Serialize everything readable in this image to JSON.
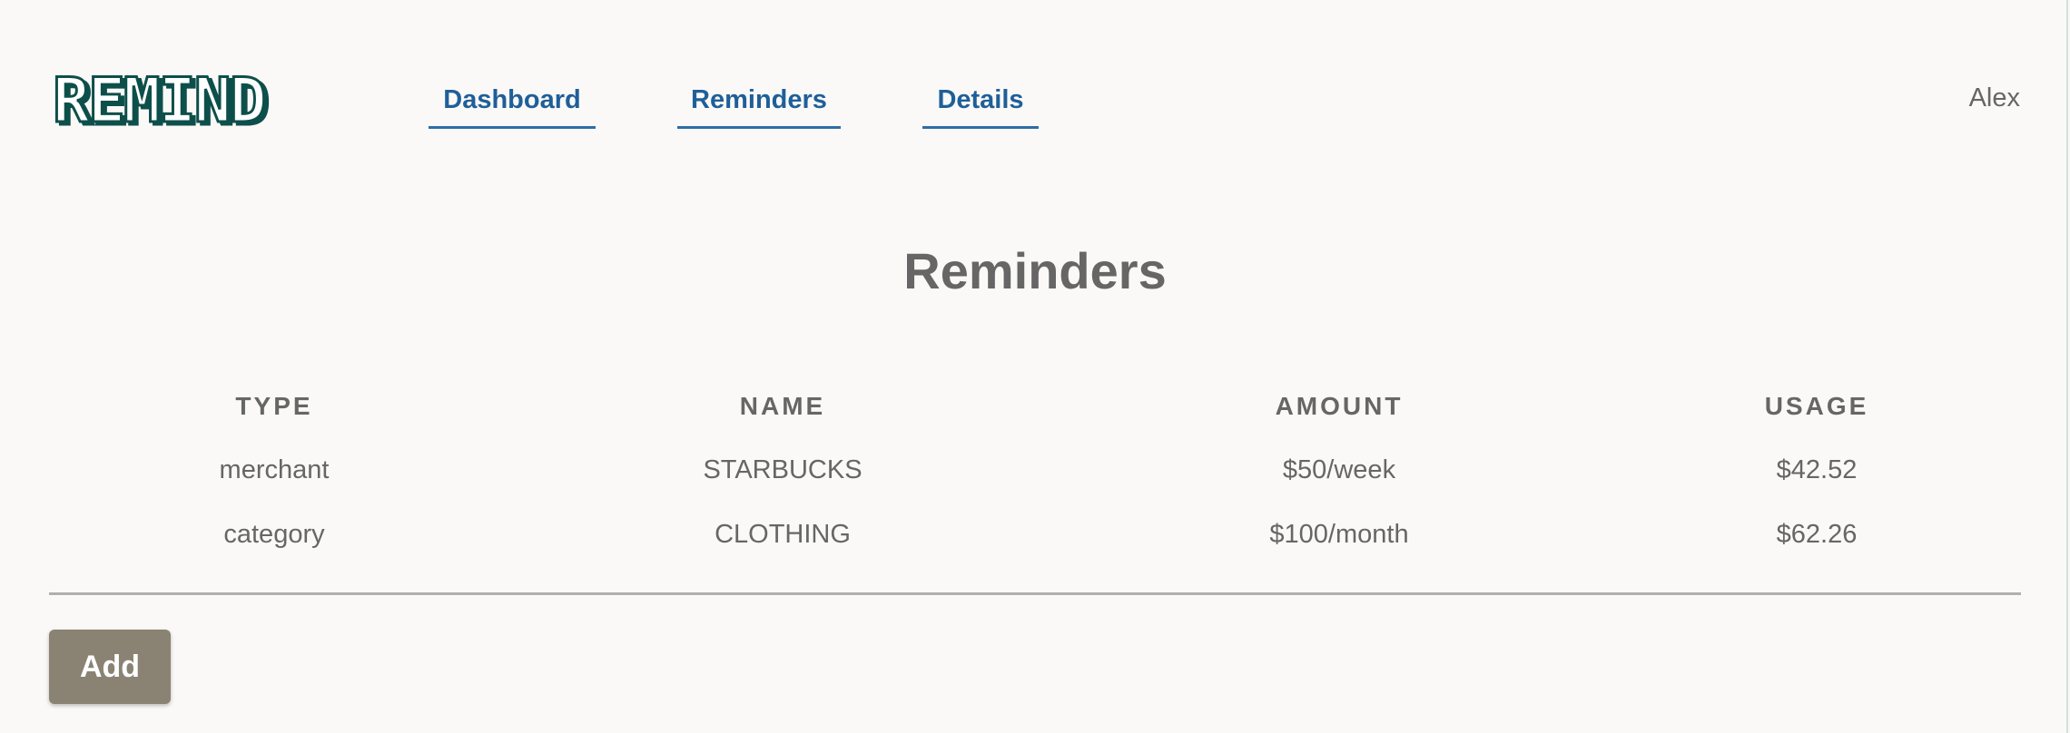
{
  "header": {
    "logo_text": "REMIND",
    "nav": [
      {
        "label": "Dashboard"
      },
      {
        "label": "Reminders"
      },
      {
        "label": "Details"
      }
    ],
    "user": "Alex"
  },
  "main": {
    "title": "Reminders",
    "table": {
      "columns": [
        "TYPE",
        "NAME",
        "AMOUNT",
        "USAGE"
      ],
      "rows": [
        {
          "type": "merchant",
          "name": "STARBUCKS",
          "amount": "$50/week",
          "usage": "$42.52"
        },
        {
          "type": "category",
          "name": "CLOTHING",
          "amount": "$100/month",
          "usage": "$62.26"
        }
      ]
    },
    "add_label": "Add"
  },
  "colors": {
    "background": "#faf9f7",
    "nav_link": "#1f5f99",
    "logo": "#0d4f4a",
    "button": "#8a8373",
    "text": "#666666"
  }
}
